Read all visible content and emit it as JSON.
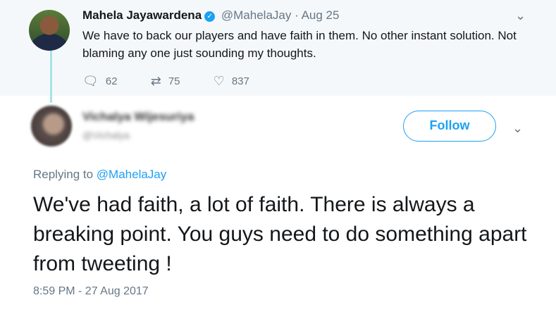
{
  "parent_tweet": {
    "name": "Mahela Jayawardena",
    "verified_icon": "verified-badge-icon",
    "handle": "@MahelaJay",
    "separator": "·",
    "date": "Aug 25",
    "text": "We have to back our players and have faith in them. No other instant solution. Not blaming any one just sounding my thoughts.",
    "replies": "62",
    "retweets": "75",
    "likes": "837"
  },
  "reply_tweet": {
    "name": "Vichalya Wijesuriya",
    "handle": "@Vichalya",
    "follow_label": "Follow",
    "replying_to_prefix": "Replying to ",
    "replying_to_handle": "@MahelaJay",
    "text": "We've had faith, a lot of faith. There is always a breaking point. You guys need to do something apart from tweeting !",
    "timestamp": "8:59 PM - 27 Aug 2017"
  },
  "colors": {
    "accent": "#1da1f2",
    "muted": "#657786",
    "parent_bg": "#f5f8fa",
    "thread": "#a6e3e9"
  }
}
